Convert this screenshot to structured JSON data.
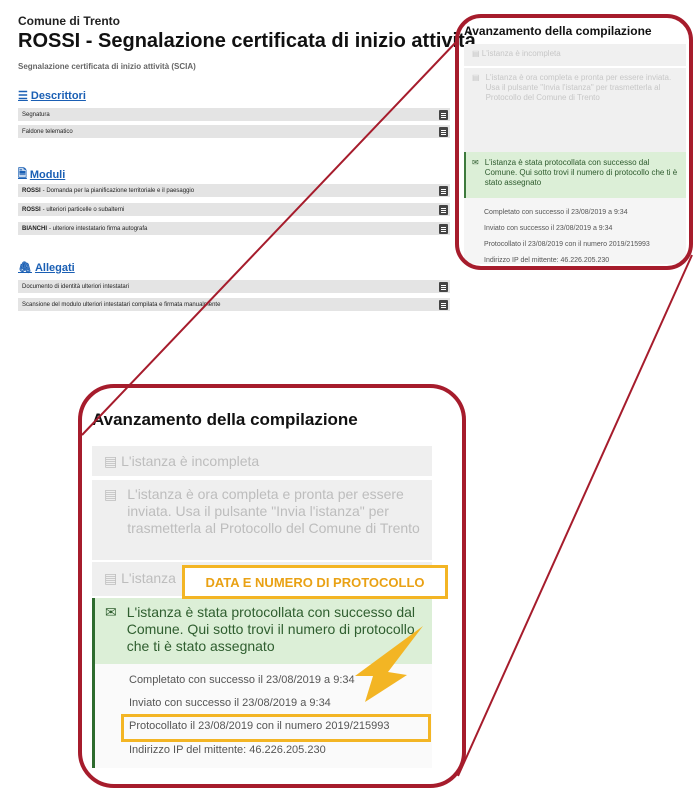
{
  "header": {
    "municipality": "Comune di Trento",
    "title": "ROSSI - Segnalazione certificata di inizio attività",
    "subtitle": "Segnalazione certificata di inizio attività (SCIA)"
  },
  "sections": {
    "descrittori": {
      "label": "Descrittori",
      "rows": [
        "Segnatura",
        "Faldone telematico"
      ]
    },
    "moduli": {
      "label": "Moduli",
      "rows": [
        {
          "bold": "ROSSI",
          "text": " - Domanda per la pianificazione territoriale e il paesaggio"
        },
        {
          "bold": "ROSSI",
          "text": " - ulteriori particelle o subalterni"
        },
        {
          "bold": "BIANCHI",
          "text": "  - ulteriore intestatario firma autografa"
        }
      ]
    },
    "allegati": {
      "label": "Allegati",
      "rows": [
        "Documento di identità ulteriori intestatari",
        "Scansione del modulo ulteriori intestatari compilata e firmata manualmente"
      ]
    }
  },
  "progress": {
    "title": "Avanzamento della compilazione",
    "incomplete": "L'istanza è incompleta",
    "complete": "L'istanza è ora completa e pronta per essere inviata. Usa il pulsante \"Invia l'istanza\" per trasmetterla al Protocollo del Comune di Trento",
    "partial": "L'istanza",
    "protocolled": "L'istanza è stata protocollata con successo dal Comune. Qui sotto trovi il numero di protocollo che ti è stato assegnato",
    "completed_at": "Completato con successo il 23/08/2019 a 9:34",
    "sent_at": "Inviato con successo il 23/08/2019 a 9:34",
    "protocol": "Protocollato il 23/08/2019 con il numero 2019/215993",
    "sender_ip": "Indirizzo IP del mittente: 46.226.205.230"
  },
  "annotation": {
    "label": "DATA E NUMERO DI PROTOCOLLO"
  },
  "colors": {
    "link_blue": "#1a5fb4",
    "oval_red": "#a61c2c",
    "highlight_yellow": "#f3b524",
    "success_green": "#dcefd7"
  }
}
